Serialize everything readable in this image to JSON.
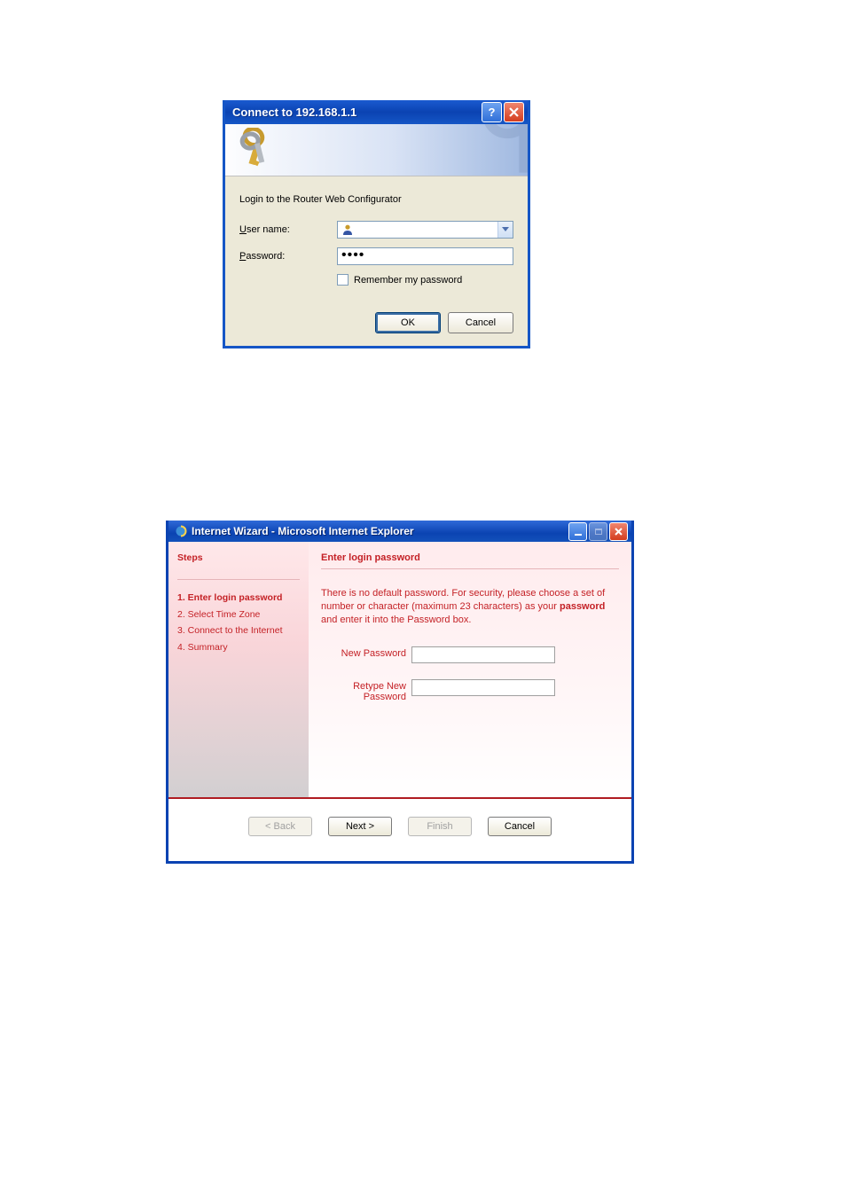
{
  "dialog1": {
    "title": "Connect to 192.168.1.1",
    "prompt": "Login to the Router Web Configurator",
    "username_prefix": "U",
    "username_rest": "ser name:",
    "password_prefix": "P",
    "password_rest": "assword:",
    "password_value": "••••",
    "remember_label": "Remember my password",
    "ok_label": "OK",
    "cancel_label": "Cancel"
  },
  "dialog2": {
    "title": "Internet Wizard - Microsoft Internet Explorer",
    "steps_heading": "Steps",
    "steps": [
      "1. Enter login password",
      "2. Select Time Zone",
      "3. Connect to the Internet",
      "4. Summary"
    ],
    "page_heading": "Enter login password",
    "description_pre": "There is no default password. For security, please choose a set of number or character (maximum 23 characters) as your ",
    "description_bold": "password",
    "description_post": " and enter it into the Password box.",
    "new_password_label": "New Password",
    "retype_label_line1": "Retype New",
    "retype_label_line2": "Password",
    "back_label": "< Back",
    "next_label": "Next >",
    "finish_label": "Finish",
    "cancel_label": "Cancel"
  }
}
